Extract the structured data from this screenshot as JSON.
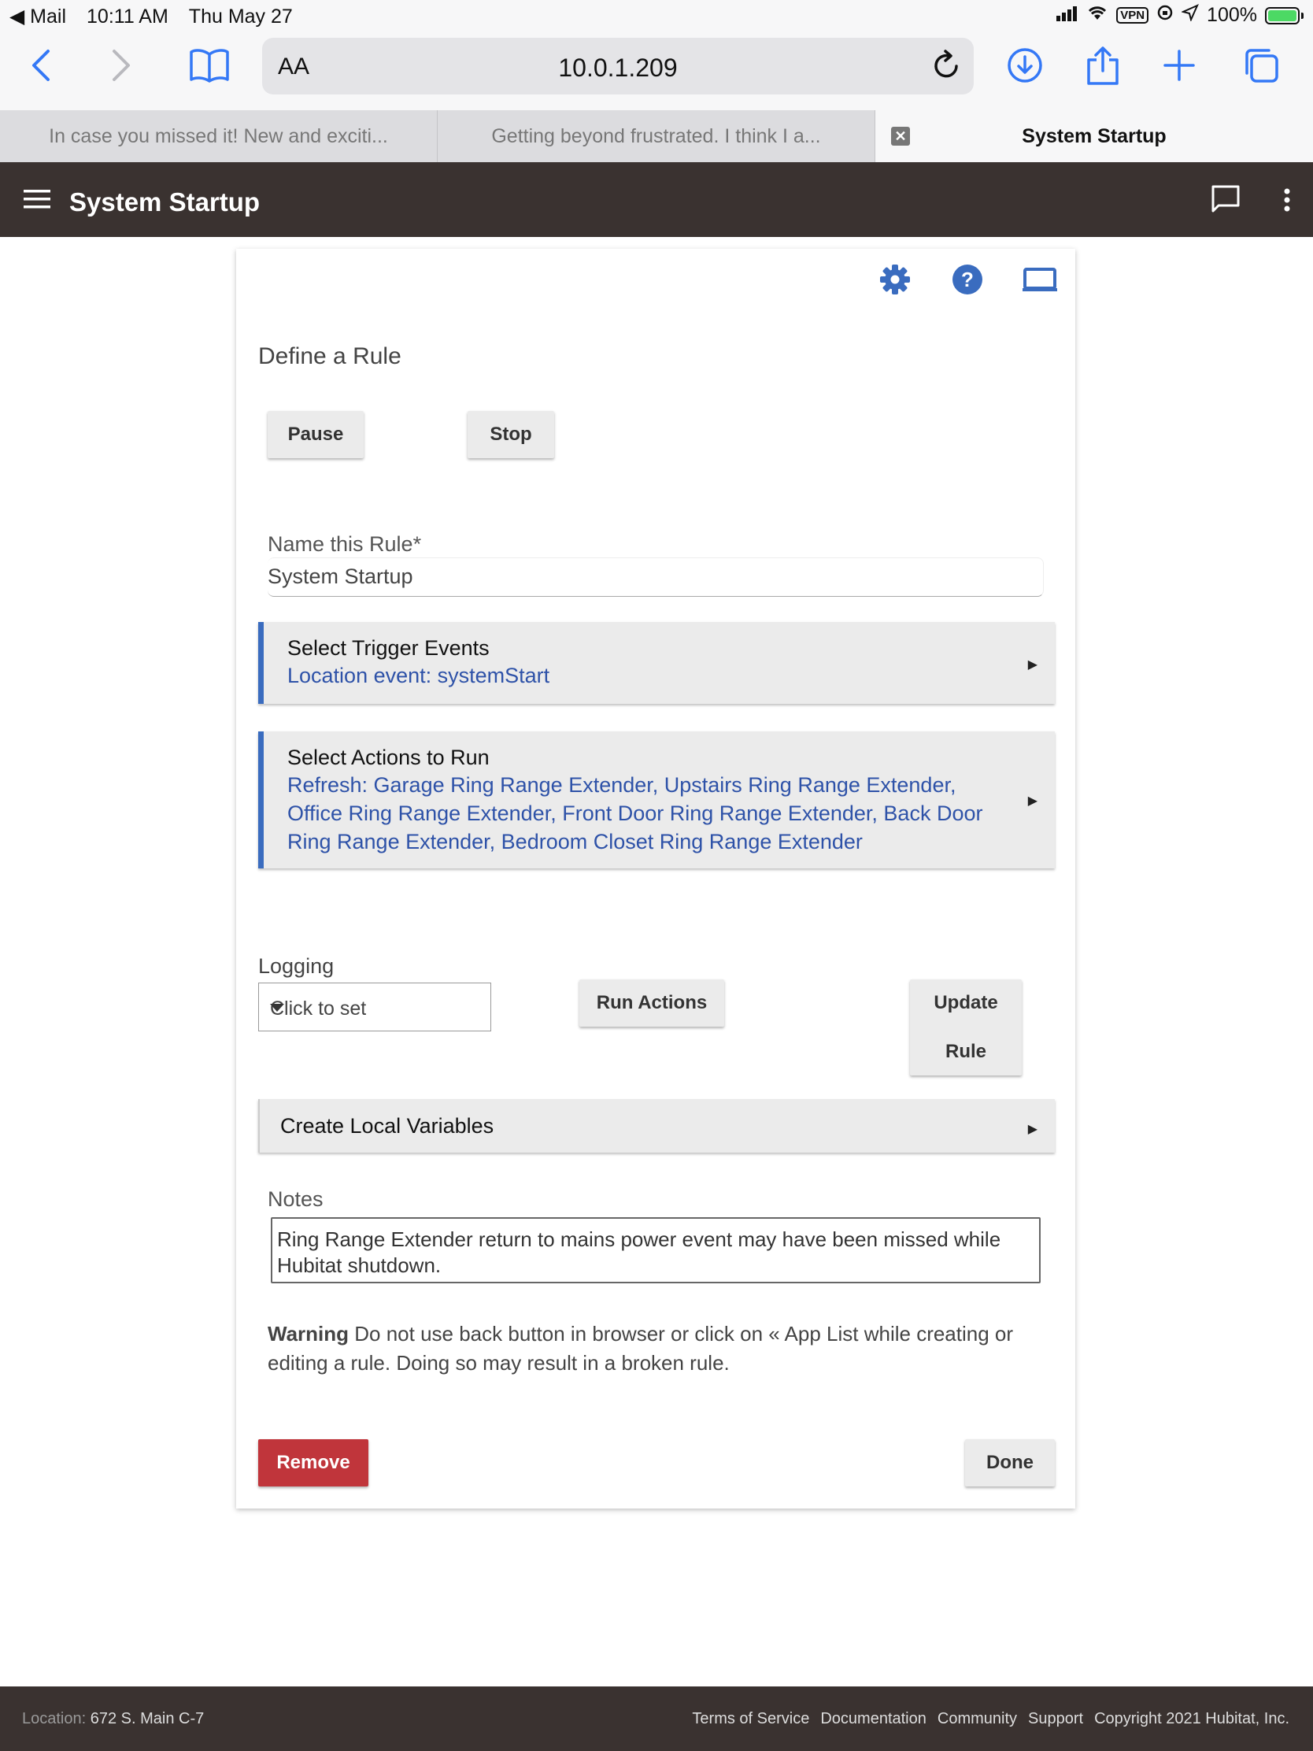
{
  "status_bar": {
    "back_app": "◀ Mail",
    "time": "10:11 AM",
    "date": "Thu May 27",
    "vpn": "VPN",
    "battery": "100%"
  },
  "browser": {
    "text_size_label": "AA",
    "url": "10.0.1.209",
    "tabs": [
      {
        "label": "In case you missed it! New and exciti..."
      },
      {
        "label": "Getting beyond frustrated. I think I a..."
      },
      {
        "label": "System Startup",
        "close": "✕"
      }
    ]
  },
  "app_bar": {
    "title": "System Startup"
  },
  "rule": {
    "section_title": "Define a Rule",
    "pause_label": "Pause",
    "stop_label": "Stop",
    "name_label": "Name this Rule*",
    "name_value": "System Startup",
    "triggers": {
      "title": "Select Trigger Events",
      "value": "Location event: systemStart"
    },
    "actions": {
      "title": "Select Actions to Run",
      "value": "Refresh: Garage Ring Range Extender, Upstairs Ring Range Extender, Office Ring Range Extender, Front Door Ring Range Extender, Back Door Ring Range Extender, Bedroom Closet Ring Range Extender"
    },
    "logging_label": "Logging",
    "logging_value": "Click to set",
    "run_actions_label": "Run Actions",
    "update_rule_line1": "Update",
    "update_rule_line2": "Rule",
    "local_vars_label": "Create Local Variables",
    "notes_label": "Notes",
    "notes_value": "Ring Range Extender return to mains power event may have been missed while Hubitat shutdown.",
    "warning_strong": "Warning",
    "warning_text": " Do not use back button in browser or click on « App List while creating or editing a rule. Doing so may result in a broken rule.",
    "remove_label": "Remove",
    "done_label": "Done"
  },
  "colors": {
    "accent": "#3a6cbf",
    "appbar_bg": "#3a3230",
    "remove_bg": "#c0353b",
    "link_value": "#2e52a8"
  },
  "footer": {
    "location_label": "Location:",
    "location_value": " 672 S. Main C-7",
    "links": [
      "Terms of Service",
      "Documentation",
      "Community",
      "Support"
    ],
    "copyright": "Copyright 2021 Hubitat, Inc."
  }
}
